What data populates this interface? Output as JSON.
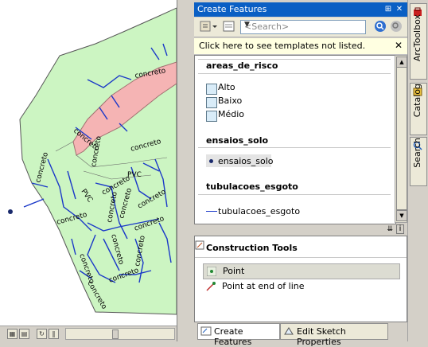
{
  "map": {
    "labels": [
      "concreto",
      "concreto",
      "concreto",
      "concreto",
      "concreto",
      "PVC",
      "PVC",
      "concreto",
      "concreto",
      "concreto",
      "concreto",
      "concreto",
      "concreto",
      "concreto",
      "concreto",
      "concreto",
      "concreto",
      "concreto"
    ]
  },
  "panel": {
    "title": "Create Features",
    "search_placeholder": "<Search>",
    "notice": "Click here to see templates not listed.",
    "groups": [
      {
        "name": "areas_de_risco",
        "items": [
          "Alto",
          "Baixo",
          "Médio"
        ]
      },
      {
        "name": "ensaios_solo",
        "items": [
          "ensaios_solo"
        ]
      },
      {
        "name": "tubulacoes_esgoto",
        "items": [
          "tubulacoes_esgoto"
        ]
      }
    ],
    "construction_tools_title": "Construction Tools",
    "tools": [
      "Point",
      "Point at end of line"
    ],
    "tabs": [
      "Create Features",
      "Edit Sketch Properties"
    ]
  },
  "dock": {
    "tabs": [
      "ArcToolbox",
      "Catalog",
      "Search"
    ]
  },
  "colors": {
    "land": "#ccf5c2",
    "risk_area": "#f5b4b4",
    "lines": "#1a38c8",
    "title_bar": "#0a5fc4",
    "notice_bg": "#ffffe1"
  }
}
